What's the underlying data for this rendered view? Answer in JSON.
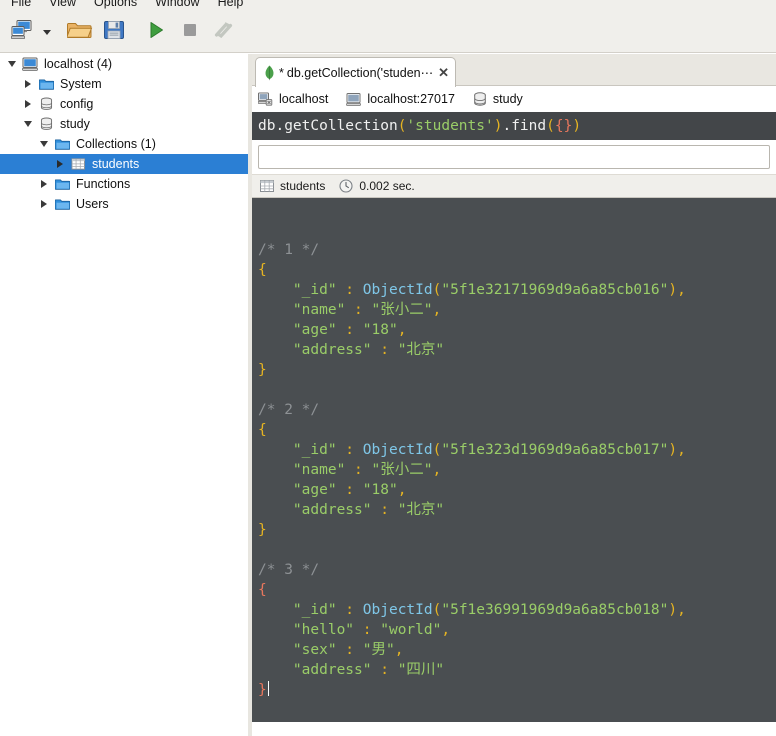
{
  "menu": {
    "items": [
      "File",
      "View",
      "Options",
      "Window",
      "Help"
    ]
  },
  "toolbar": {
    "buttons": [
      {
        "name": "connect",
        "label": "Connect",
        "icon": "computers-icon"
      },
      {
        "name": "connect-dropdown",
        "label": "",
        "icon": "chevron-down-icon"
      },
      {
        "name": "open-script",
        "label": "Open Script",
        "icon": "folder-open-icon"
      },
      {
        "name": "save-script",
        "label": "Save Script",
        "icon": "floppy-save-icon"
      },
      {
        "name": "execute",
        "label": "Execute",
        "icon": "play-green-icon"
      },
      {
        "name": "stop",
        "label": "Stop",
        "icon": "stop-square-icon"
      },
      {
        "name": "refresh",
        "label": "Refresh",
        "icon": "refresh-arrows-icon"
      }
    ]
  },
  "tree": {
    "nodes": [
      {
        "label": "localhost (4)",
        "icon": "computer-icon",
        "indent": 0,
        "twisty": "down",
        "selected": false
      },
      {
        "label": "System",
        "icon": "folder-icon",
        "indent": 1,
        "twisty": "right",
        "selected": false
      },
      {
        "label": "config",
        "icon": "database-icon",
        "indent": 1,
        "twisty": "right",
        "selected": false
      },
      {
        "label": "study",
        "icon": "database-icon",
        "indent": 1,
        "twisty": "down",
        "selected": false
      },
      {
        "label": "Collections (1)",
        "icon": "folder-icon",
        "indent": 2,
        "twisty": "down",
        "selected": false
      },
      {
        "label": "students",
        "icon": "table-grid-icon",
        "indent": 3,
        "twisty": "right",
        "selected": true
      },
      {
        "label": "Functions",
        "icon": "folder-icon",
        "indent": 2,
        "twisty": "right",
        "selected": false
      },
      {
        "label": "Users",
        "icon": "folder-icon",
        "indent": 2,
        "twisty": "right",
        "selected": false
      }
    ]
  },
  "tab": {
    "modified_marker": "*",
    "title": "db.getCollection('studen⋯",
    "close_label": "✕",
    "icon": "mongodb-leaf-icon"
  },
  "breadcrumb": {
    "items": [
      {
        "label": "localhost",
        "icon": "server-icon"
      },
      {
        "label": "localhost:27017",
        "icon": "monitor-icon"
      },
      {
        "label": "study",
        "icon": "database-icon"
      }
    ]
  },
  "editor": {
    "tokens": [
      {
        "text": "db.getCollection",
        "cls": "c-plain"
      },
      {
        "text": "(",
        "cls": "c-paren"
      },
      {
        "text": "'students'",
        "cls": "c-string"
      },
      {
        "text": ")",
        "cls": "c-paren"
      },
      {
        "text": ".find",
        "cls": "c-plain"
      },
      {
        "text": "(",
        "cls": "c-paren"
      },
      {
        "text": "{}",
        "cls": "c-brace"
      },
      {
        "text": ")",
        "cls": "c-paren"
      }
    ],
    "full_text": "db.getCollection('students').find({})"
  },
  "filter": {
    "value": "",
    "placeholder": ""
  },
  "status": {
    "collection": "students",
    "collection_icon": "table-grid-icon",
    "time": "0.002 sec.",
    "time_icon": "clock-icon"
  },
  "results": {
    "documents": [
      {
        "comment": "/* 1 */",
        "brace_highlight": false,
        "fields": [
          {
            "key": "\"_id\"",
            "value": "ObjectId(\"5f1e32171969d9a6a85cb016\")",
            "type": "objectid",
            "oid": "5f1e32171969d9a6a85cb016",
            "trailing_comma": true
          },
          {
            "key": "\"name\"",
            "value": "\"张小二\"",
            "type": "string",
            "trailing_comma": true
          },
          {
            "key": "\"age\"",
            "value": "\"18\"",
            "type": "string",
            "trailing_comma": true
          },
          {
            "key": "\"address\"",
            "value": "\"北京\"",
            "type": "string",
            "trailing_comma": false
          }
        ]
      },
      {
        "comment": "/* 2 */",
        "brace_highlight": false,
        "fields": [
          {
            "key": "\"_id\"",
            "value": "ObjectId(\"5f1e323d1969d9a6a85cb017\")",
            "type": "objectid",
            "oid": "5f1e323d1969d9a6a85cb017",
            "trailing_comma": true
          },
          {
            "key": "\"name\"",
            "value": "\"张小二\"",
            "type": "string",
            "trailing_comma": true
          },
          {
            "key": "\"age\"",
            "value": "\"18\"",
            "type": "string",
            "trailing_comma": true
          },
          {
            "key": "\"address\"",
            "value": "\"北京\"",
            "type": "string",
            "trailing_comma": false
          }
        ]
      },
      {
        "comment": "/* 3 */",
        "brace_highlight": true,
        "fields": [
          {
            "key": "\"_id\"",
            "value": "ObjectId(\"5f1e36991969d9a6a85cb018\")",
            "type": "objectid",
            "oid": "5f1e36991969d9a6a85cb018",
            "trailing_comma": true
          },
          {
            "key": "\"hello\"",
            "value": "\"world\"",
            "type": "string",
            "trailing_comma": true
          },
          {
            "key": "\"sex\"",
            "value": "\"男\"",
            "type": "string",
            "trailing_comma": true
          },
          {
            "key": "\"address\"",
            "value": "\"四川\"",
            "type": "string",
            "trailing_comma": false
          }
        ]
      }
    ]
  },
  "colors": {
    "chrome": "#f0efeb",
    "selection_blue": "#2b7fd4",
    "editor_bg": "#434649",
    "results_bg": "#4a4e51",
    "token_string": "#9acd68",
    "token_paren": "#e6b422",
    "token_brace": "#e8775d",
    "token_fn": "#7fc7e8",
    "comment": "#8d9194"
  }
}
